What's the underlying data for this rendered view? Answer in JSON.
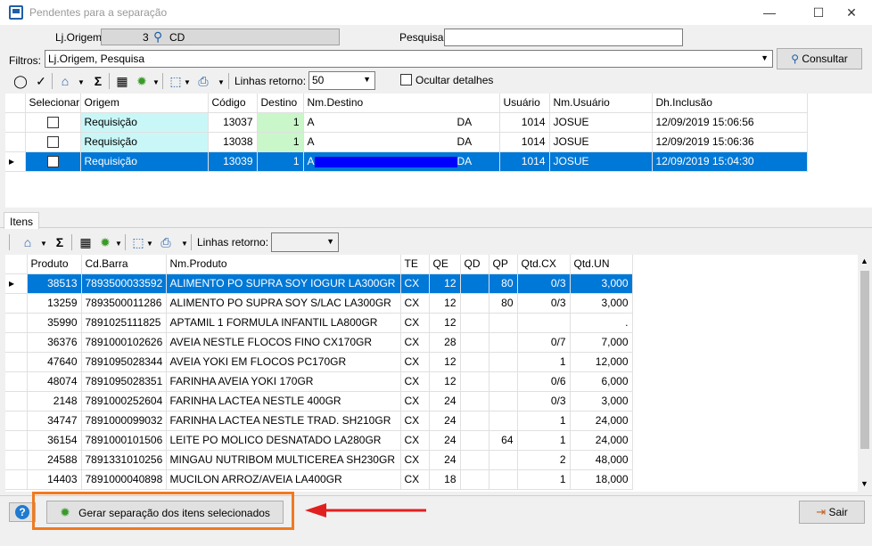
{
  "window": {
    "title": "Pendentes para a separação",
    "minimize": "—",
    "maximize": "☐",
    "close": "✕"
  },
  "header": {
    "lj_origem_label": "Lj.Origem",
    "lj_origem_value": "3",
    "lj_origem_code": "CD",
    "pesquisa_label": "Pesquisa",
    "pesquisa_value": "",
    "filtros_label": "Filtros:",
    "filtros_value": "Lj.Origem, Pesquisa",
    "consultar_label": "Consultar"
  },
  "toolbar": {
    "linhas_label": "Linhas retorno:",
    "linhas_value": "50",
    "ocultar_label": "Ocultar detalhes"
  },
  "top_grid": {
    "columns": [
      "Selecionar",
      "Origem",
      "Código",
      "Destino",
      "Nm.Destino",
      "Usuário",
      "Nm.Usuário",
      "Dh.Inclusão"
    ],
    "rows": [
      {
        "origem": "Requisição",
        "codigo": "13037",
        "destino": "1",
        "nm_destino_a": "A",
        "nm_destino_b": "DA",
        "usuario": "1014",
        "nm_usuario": "JOSUE",
        "dh": "12/09/2019 15:06:56"
      },
      {
        "origem": "Requisição",
        "codigo": "13038",
        "destino": "1",
        "nm_destino_a": "A",
        "nm_destino_b": "DA",
        "usuario": "1014",
        "nm_usuario": "JOSUE",
        "dh": "12/09/2019 15:06:36"
      },
      {
        "origem": "Requisição",
        "codigo": "13039",
        "destino": "1",
        "nm_destino_a": "A",
        "nm_destino_b": "DA",
        "usuario": "1014",
        "nm_usuario": "JOSUE",
        "dh": "12/09/2019 15:04:30"
      }
    ]
  },
  "itens_tab": "Itens",
  "itens_toolbar": {
    "linhas_label": "Linhas retorno:",
    "linhas_value": ""
  },
  "items_grid": {
    "columns": [
      "Produto",
      "Cd.Barra",
      "Nm.Produto",
      "TE",
      "QE",
      "QD",
      "QP",
      "Qtd.CX",
      "Qtd.UN"
    ],
    "rows": [
      [
        "38513",
        "7893500033592",
        "ALIMENTO PO SUPRA SOY IOGUR LA300GR",
        "CX",
        "12",
        "",
        "80",
        "0/3",
        "3,000"
      ],
      [
        "13259",
        "7893500011286",
        "ALIMENTO PO SUPRA SOY S/LAC LA300GR",
        "CX",
        "12",
        "",
        "80",
        "0/3",
        "3,000"
      ],
      [
        "35990",
        "7891025111825",
        "APTAMIL 1 FORMULA INFANTIL LA800GR",
        "CX",
        "12",
        "",
        "",
        "",
        "."
      ],
      [
        "36376",
        "7891000102626",
        "AVEIA NESTLE FLOCOS FINO CX170GR",
        "CX",
        "28",
        "",
        "",
        "0/7",
        "7,000"
      ],
      [
        "47640",
        "7891095028344",
        "AVEIA YOKI EM FLOCOS PC170GR",
        "CX",
        "12",
        "",
        "",
        "1",
        "12,000"
      ],
      [
        "48074",
        "7891095028351",
        "FARINHA AVEIA YOKI 170GR",
        "CX",
        "12",
        "",
        "",
        "0/6",
        "6,000"
      ],
      [
        "2148",
        "7891000252604",
        "FARINHA LACTEA NESTLE 400GR",
        "CX",
        "24",
        "",
        "",
        "0/3",
        "3,000"
      ],
      [
        "34747",
        "7891000099032",
        "FARINHA LACTEA NESTLE TRAD. SH210GR",
        "CX",
        "24",
        "",
        "",
        "1",
        "24,000"
      ],
      [
        "36154",
        "7891000101506",
        "LEITE PO MOLICO DESNATADO LA280GR",
        "CX",
        "24",
        "",
        "64",
        "1",
        "24,000"
      ],
      [
        "24588",
        "7891331010256",
        "MINGAU NUTRIBOM  MULTICEREA SH230GR",
        "CX",
        "24",
        "",
        "",
        "2",
        "48,000"
      ],
      [
        "14403",
        "7891000040898",
        "MUCILON ARROZ/AVEIA LA400GR",
        "CX",
        "18",
        "",
        "",
        "1",
        "18,000"
      ]
    ]
  },
  "footer": {
    "help_label": "?",
    "gerar_label": "Gerar separação dos itens selecionados",
    "sair_label": "Sair"
  },
  "colors": {
    "selection": "#0078d7",
    "highlight": "#f07a20",
    "arrow": "#e02020"
  }
}
